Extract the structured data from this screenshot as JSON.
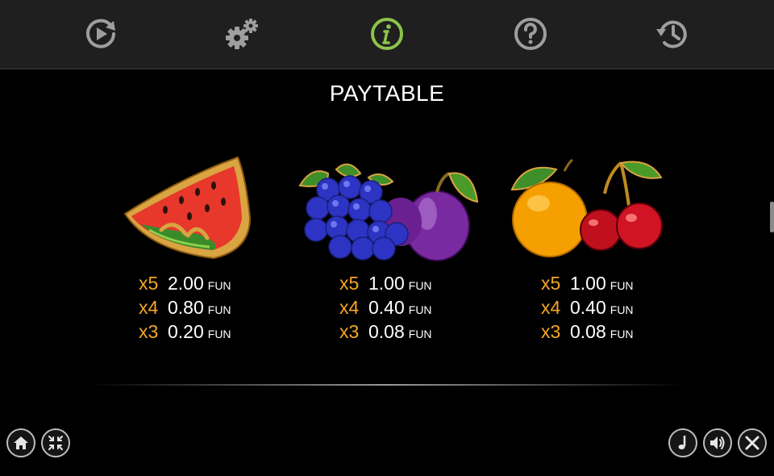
{
  "nav": {
    "tabs": [
      {
        "icon": "autoplay-icon",
        "active": false
      },
      {
        "icon": "settings-icon",
        "active": false
      },
      {
        "icon": "info-icon",
        "active": true
      },
      {
        "icon": "help-icon",
        "active": false
      },
      {
        "icon": "history-icon",
        "active": false
      }
    ],
    "active_color": "#8bc34a",
    "icon_color": "#9e9e9e"
  },
  "title": "PAYTABLE",
  "symbols": [
    {
      "icon": "watermelon-icon",
      "payouts": [
        {
          "multiplier": "x5",
          "value": "2.00",
          "unit": "FUN"
        },
        {
          "multiplier": "x4",
          "value": "0.80",
          "unit": "FUN"
        },
        {
          "multiplier": "x3",
          "value": "0.20",
          "unit": "FUN"
        }
      ]
    },
    {
      "icon": "grapes-plum-icon",
      "payouts": [
        {
          "multiplier": "x5",
          "value": "1.00",
          "unit": "FUN"
        },
        {
          "multiplier": "x4",
          "value": "0.40",
          "unit": "FUN"
        },
        {
          "multiplier": "x3",
          "value": "0.08",
          "unit": "FUN"
        }
      ]
    },
    {
      "icon": "orange-cherry-icon",
      "payouts": [
        {
          "multiplier": "x5",
          "value": "1.00",
          "unit": "FUN"
        },
        {
          "multiplier": "x4",
          "value": "0.40",
          "unit": "FUN"
        },
        {
          "multiplier": "x3",
          "value": "0.08",
          "unit": "FUN"
        }
      ]
    }
  ],
  "bottom_left_buttons": [
    "home-icon",
    "exit-fullscreen-icon"
  ],
  "bottom_right_buttons": [
    "music-icon",
    "sound-icon",
    "close-icon"
  ],
  "colors": {
    "multiplier": "#f5a623",
    "button_border": "#bdbdbd",
    "topbar": "#1f1f1f"
  }
}
